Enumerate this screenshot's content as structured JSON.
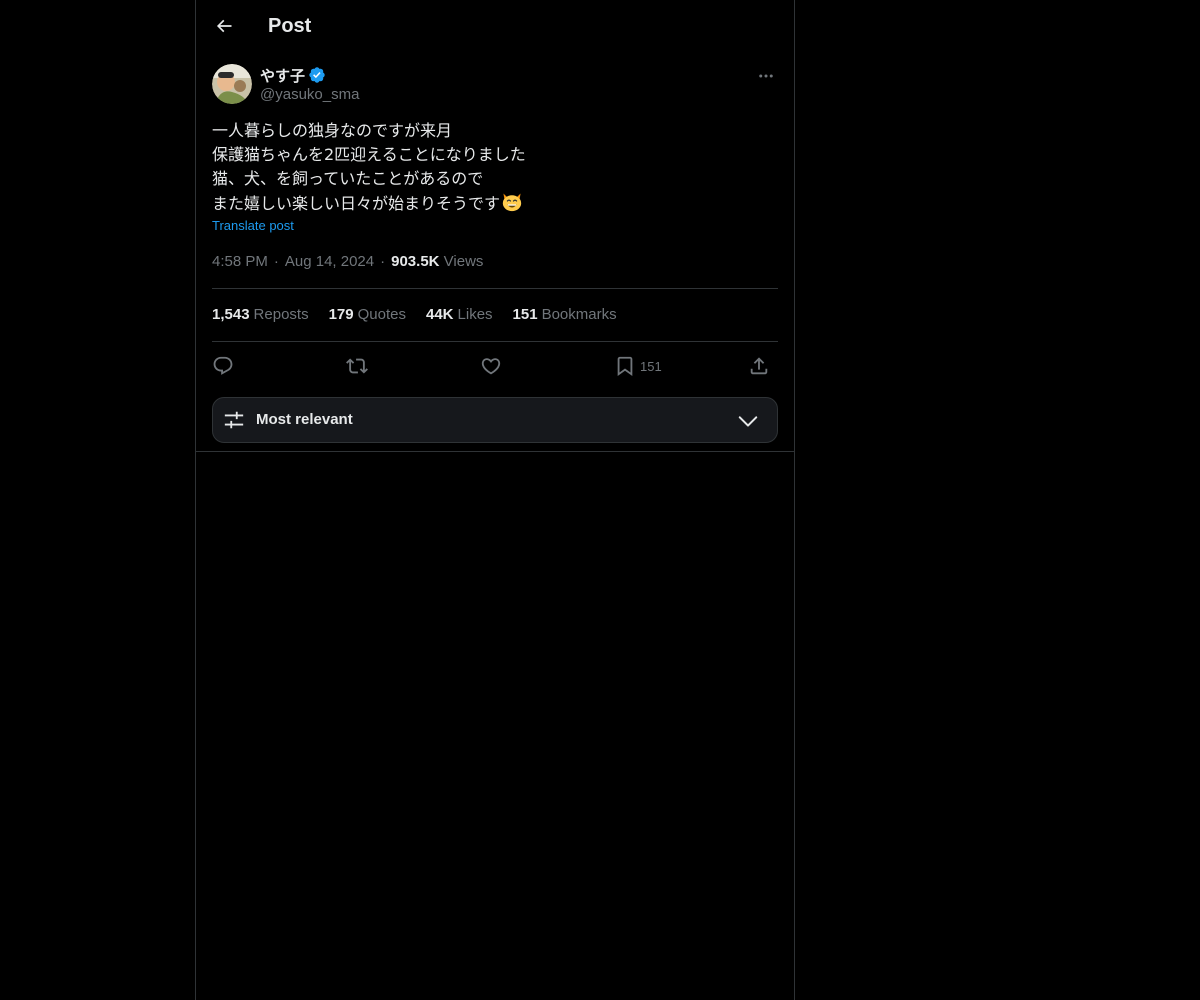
{
  "header": {
    "back_icon": "arrow-left-icon",
    "title": "Post"
  },
  "author": {
    "display_name": "やす子",
    "verified_icon": "verified-badge-icon",
    "handle": "@yasuko_sma",
    "more_icon": "more-horizontal-icon"
  },
  "post": {
    "lines": [
      "一人暮らしの独身なのですが来月",
      "保護猫ちゃんを2匹迎えることになりました",
      "猫、犬、を飼っていたことがあるので",
      "また嬉しい楽しい日々が始まりそうです"
    ],
    "emoji": "grinning-cat-emoji",
    "translate_label": "Translate post"
  },
  "meta": {
    "time": "4:58 PM",
    "separator": "·",
    "date": "Aug 14, 2024",
    "views_count": "903.5K",
    "views_label": "Views"
  },
  "stats": [
    {
      "count": "1,543",
      "label": "Reposts"
    },
    {
      "count": "179",
      "label": "Quotes"
    },
    {
      "count": "44K",
      "label": "Likes"
    },
    {
      "count": "151",
      "label": "Bookmarks"
    }
  ],
  "actions": {
    "reply_icon": "reply-icon",
    "repost_icon": "repost-icon",
    "like_icon": "heart-icon",
    "bookmark_icon": "bookmark-icon",
    "bookmark_count": "151",
    "share_icon": "share-icon"
  },
  "sort": {
    "icon": "sliders-icon",
    "label": "Most relevant",
    "chevron_icon": "chevron-down-icon"
  },
  "colors": {
    "background": "#000000",
    "text_primary": "#e7e9ea",
    "text_secondary": "#71767b",
    "accent": "#1d9bf0",
    "border": "#2f3336"
  }
}
